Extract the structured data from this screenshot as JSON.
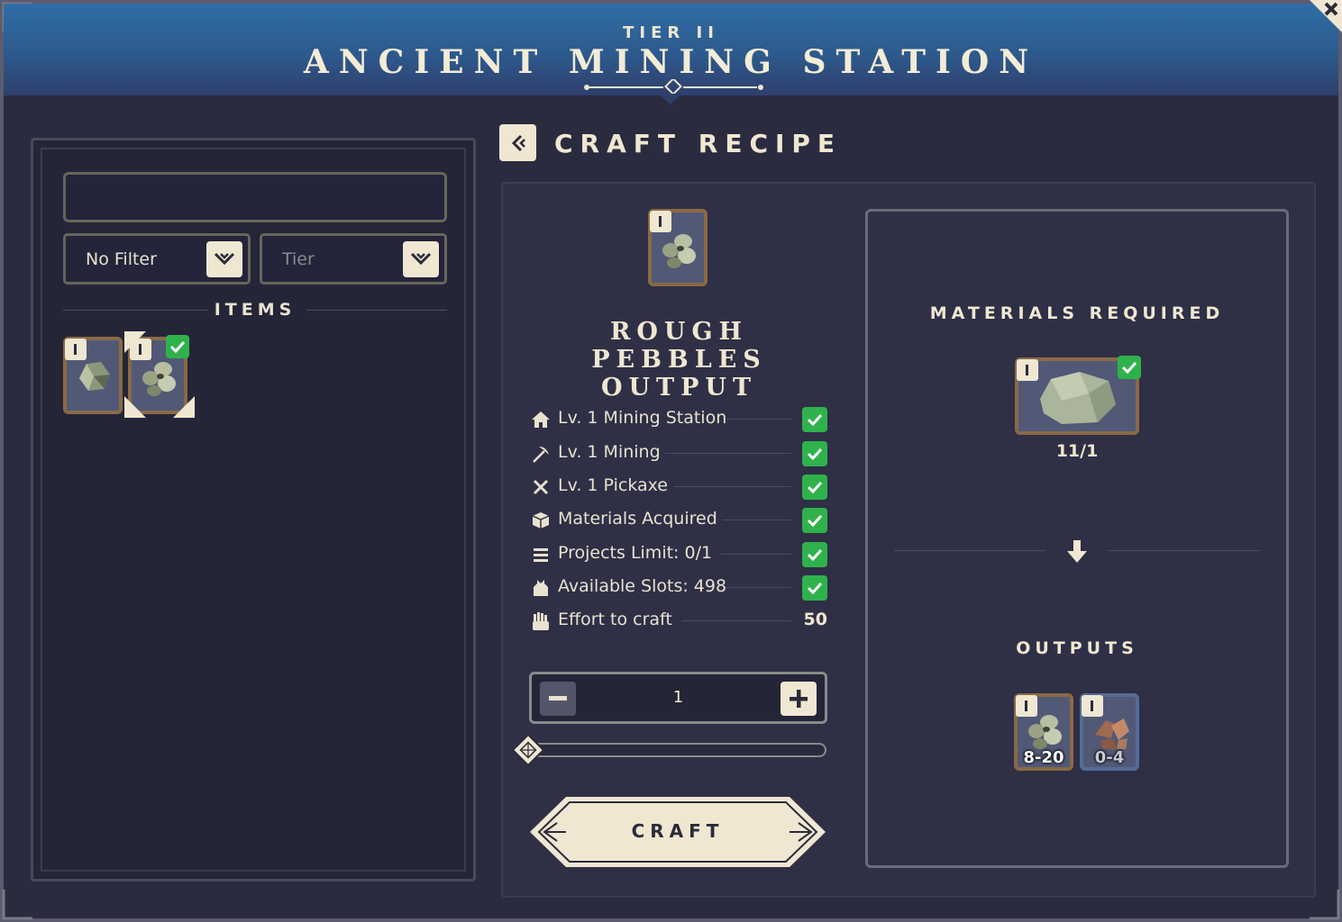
{
  "header": {
    "tier": "TIER II",
    "title": "ANCIENT MINING STATION"
  },
  "left_panel": {
    "search": {
      "value": "",
      "placeholder": ""
    },
    "filter_select": {
      "selected": "No Filter"
    },
    "tier_select": {
      "placeholder": "Tier"
    },
    "items_heading": "ITEMS",
    "items": [
      {
        "name": "stone-chunk",
        "tier_icon": "I",
        "selected": false,
        "checked": false
      },
      {
        "name": "rough-pebbles",
        "tier_icon": "I",
        "selected": true,
        "checked": true
      }
    ]
  },
  "recipe": {
    "heading": "CRAFT RECIPE",
    "title": "ROUGH PEBBLES OUTPUT",
    "requirements": [
      {
        "icon": "house-icon",
        "label": "Lv. 1 Mining Station",
        "status": "met"
      },
      {
        "icon": "pickaxe-icon",
        "label": "Lv. 1 Mining",
        "status": "met"
      },
      {
        "icon": "crossed-tools-icon",
        "label": "Lv. 1 Pickaxe",
        "status": "met"
      },
      {
        "icon": "cube-icon",
        "label": "Materials Acquired",
        "status": "met"
      },
      {
        "icon": "list-icon",
        "label": "Projects Limit: 0/1",
        "status": "met"
      },
      {
        "icon": "bag-icon",
        "label": "Available Slots: 498",
        "status": "met"
      },
      {
        "icon": "fist-icon",
        "label": "Effort to craft",
        "value": "50"
      }
    ],
    "quantity": "1",
    "slider_fraction": 0,
    "craft_label": "CRAFT"
  },
  "materials": {
    "heading": "MATERIALS REQUIRED",
    "items": [
      {
        "name": "rough-stone",
        "tier_icon": "I",
        "count": "11/1",
        "checked": true
      }
    ],
    "outputs_heading": "OUTPUTS",
    "outputs": [
      {
        "name": "rough-pebbles",
        "tier_icon": "I",
        "quantity": "8-20",
        "frame": "brown"
      },
      {
        "name": "copper-ore",
        "tier_icon": "I",
        "quantity": "0-4",
        "frame": "blue"
      }
    ]
  },
  "colors": {
    "header_top": "#2f6ea6",
    "header_bottom": "#2f3f6c",
    "panel_bg": "#2f2f46",
    "accent_cream": "#efe7d2",
    "check_green": "#2fb24c",
    "tile_brown_frame": "#8a6a45",
    "tile_blue_frame": "#536d96"
  }
}
